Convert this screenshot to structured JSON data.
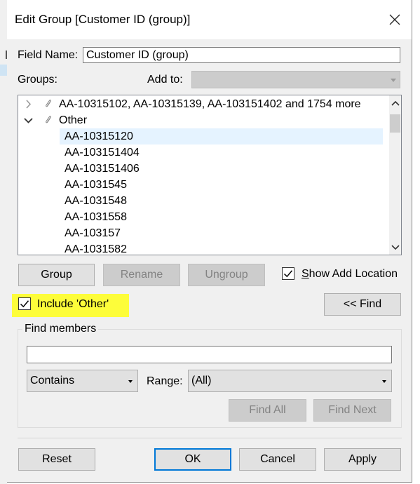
{
  "dialog": {
    "title": "Edit Group [Customer ID (group)]"
  },
  "field_name": {
    "label": "Field Name:",
    "value": "Customer ID (group)"
  },
  "groups": {
    "label": "Groups:",
    "add_to_label": "Add to:",
    "add_to_value": ""
  },
  "tree": {
    "groups": [
      {
        "label": "AA-10315102, AA-10315139, AA-103151402 and 1754 more",
        "expanded": false
      },
      {
        "label": "Other",
        "expanded": true
      }
    ],
    "other_members": [
      "AA-10315120",
      "AA-103151404",
      "AA-103151406",
      "AA-1031545",
      "AA-1031548",
      "AA-1031558",
      "AA-103157",
      "AA-1031582"
    ],
    "selected_member": "AA-10315120"
  },
  "buttons": {
    "group": "Group",
    "rename": "Rename",
    "ungroup": "Ungroup",
    "find_toggle": "<< Find",
    "find_all": "Find All",
    "find_next": "Find Next",
    "reset": "Reset",
    "ok": "OK",
    "cancel": "Cancel",
    "apply": "Apply"
  },
  "options": {
    "show_add_location_label": "Show Add Location",
    "show_add_location_checked": true,
    "include_other_label": "Include 'Other'",
    "include_other_checked": true,
    "highlight_color": "#fdfd3a"
  },
  "find": {
    "legend": "Find members",
    "query": "",
    "match_mode": "Contains",
    "range_label": "Range:",
    "range_value": "(All)"
  },
  "colors": {
    "accent": "#0078d7",
    "selection": "#e5f3ff",
    "dialog_bg": "#f0f0f0"
  }
}
